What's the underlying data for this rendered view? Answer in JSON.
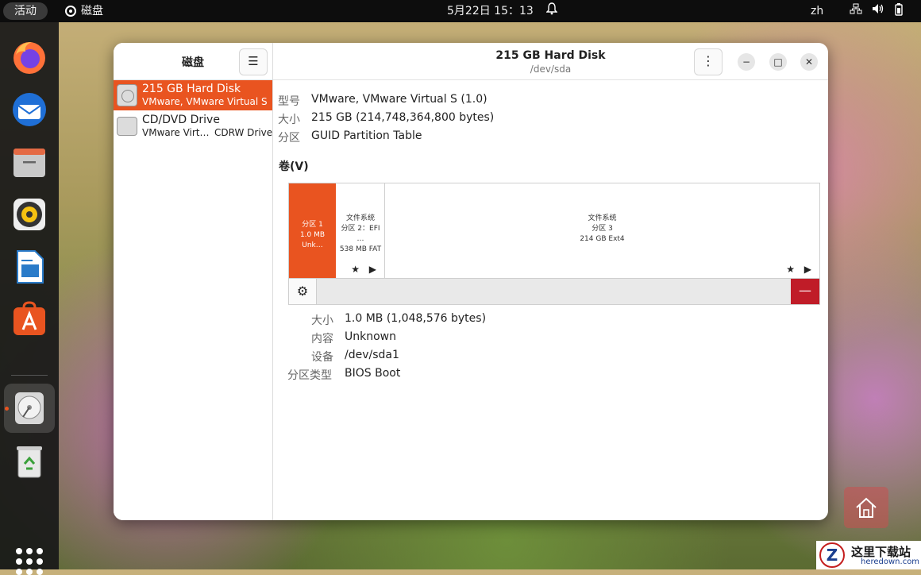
{
  "topbar": {
    "activities": "活动",
    "app_name": "磁盘",
    "clock": "5月22日  15：13",
    "lang": "zh"
  },
  "dock": {
    "apps": [
      {
        "name": "firefox-icon"
      },
      {
        "name": "thunderbird-icon"
      },
      {
        "name": "files-icon"
      },
      {
        "name": "rhythmbox-icon"
      },
      {
        "name": "libreoffice-writer-icon"
      },
      {
        "name": "app-center-icon"
      },
      {
        "name": "disks-icon"
      },
      {
        "name": "trash-icon"
      }
    ],
    "accent": "#e95420"
  },
  "sidebar": {
    "title": "磁盘",
    "disks": [
      {
        "name": "215 GB Hard Disk",
        "sub": "VMware, VMware Virtual S",
        "sub2": ""
      },
      {
        "name": "CD/DVD Drive",
        "sub": "VMware Virt…",
        "sub2": "CDRW Drive"
      }
    ]
  },
  "main": {
    "title": "215 GB Hard Disk",
    "subtitle": "/dev/sda",
    "info": [
      {
        "label": "型号",
        "value": "VMware, VMware Virtual S (1.0)"
      },
      {
        "label": "大小",
        "value": "215 GB (214,748,364,800 bytes)"
      },
      {
        "label": "分区",
        "value": "GUID Partition Table"
      }
    ],
    "volumes_title": "卷(V)",
    "partitions": [
      {
        "line1": "分区 1",
        "line2": "1.0 MB Unk…",
        "line3": ""
      },
      {
        "line1": "文件系统",
        "line2": "分区 2：EFI …",
        "line3": "538 MB FAT"
      },
      {
        "line1": "文件系统",
        "line2": "分区 3",
        "line3": "214 GB Ext4"
      }
    ],
    "partition_marks": "★ ▶",
    "details": [
      {
        "label": "大小",
        "value": "1.0 MB (1,048,576 bytes)"
      },
      {
        "label": "内容",
        "value": "Unknown"
      },
      {
        "label": "设备",
        "value": "/dev/sda1"
      },
      {
        "label": "分区类型",
        "value": "BIOS Boot"
      }
    ],
    "delete_glyph": "—"
  },
  "watermark": {
    "logo_letter": "Z",
    "text_cn": "这里下载站",
    "text_en": "heredown.com"
  }
}
